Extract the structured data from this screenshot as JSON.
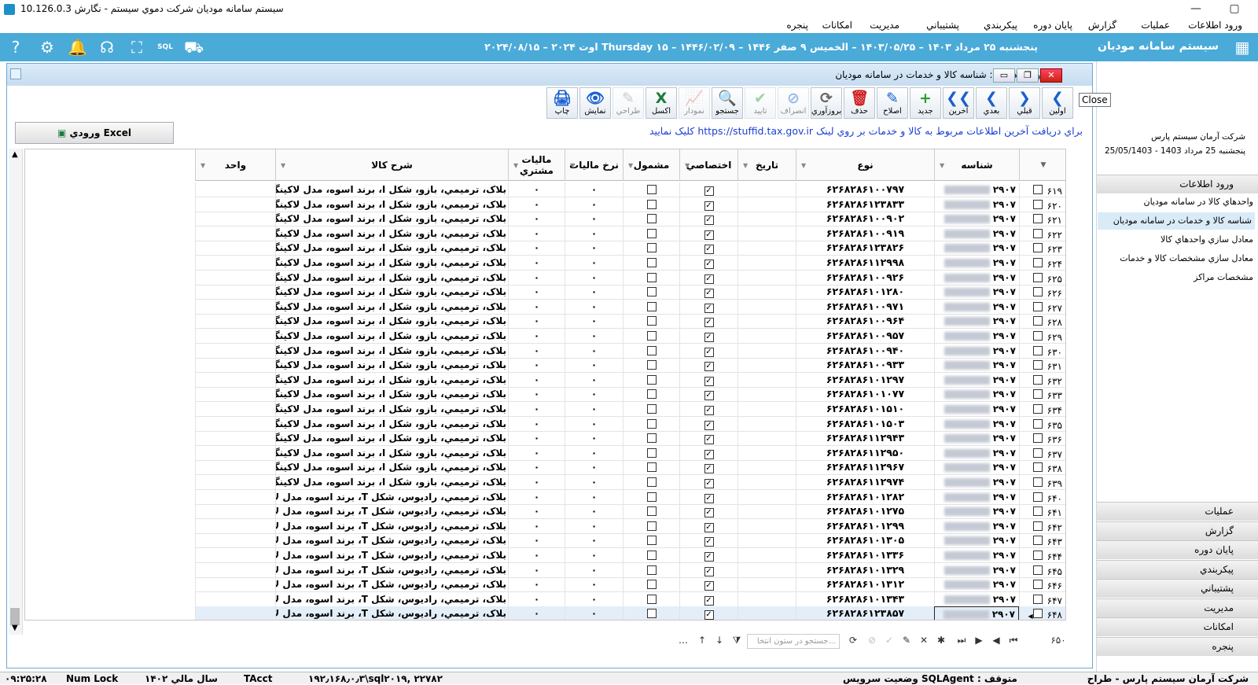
{
  "window": {
    "title": "سيستم سامانه موديان شرکت دموي سيستم - نگارش 10.126.0.3"
  },
  "menu": [
    "ورود اطلاعات",
    "عمليات",
    "گزارش",
    "پايان دوره",
    "پيکربندي",
    "پشتيباني",
    "مديريت",
    "امکانات",
    "پنجره"
  ],
  "header": {
    "app_name": "سيستم سامانه موديان",
    "date_line": "پنجشنبه ۲۵ مرداد ۱۴۰۳ – ۱۴۰۳/۰۵/۲۵ – الخميس ۹ صفر ۱۴۴۶ – ۱۴۴۶/۰۲/۰۹ – Thursday ۱۵ اوت ۲۰۲۴ – ۲۰۲۴/۰۸/۱۵",
    "icons": [
      "help-icon",
      "settings-icon",
      "bell-icon",
      "support-icon",
      "gift-icon",
      "sql-icon",
      "truck-icon"
    ]
  },
  "right_panel": {
    "company": "شرکت آرمان سيستم پارس",
    "date": "پنجشنبه 25 مرداد 1403 - 25/05/1403",
    "sections": [
      {
        "label": "ورود اطلاعات",
        "items": [
          "واحدهاي کالا در سامانه موديان",
          "شناسه کالا و خدمات در سامانه موديان",
          "معادل سازي واحدهاي کالا",
          "معادل سازي  مشخصات کالا و خدمات",
          "مشخصات مراکز"
        ],
        "selected": 1
      }
    ],
    "collapsed": [
      "عمليات",
      "گزارش",
      "پايان دوره",
      "پيکربندي",
      "پشتيباني",
      "مديريت",
      "امکانات",
      "پنجره"
    ]
  },
  "child_window": {
    "title": "ورود اطلاعات : شناسه کالا و خدمات در سامانه موديان",
    "tooltip": "Close"
  },
  "toolbar": [
    {
      "id": "first",
      "label": "اولين",
      "glyph": "❮",
      "color": "#1a5fd0",
      "disabled": false
    },
    {
      "id": "prev",
      "label": "قبلي",
      "glyph": "❯",
      "color": "#1a5fd0",
      "disabled": false
    },
    {
      "id": "next",
      "label": "بعدي",
      "glyph": "❮",
      "color": "#1a5fd0",
      "disabled": false
    },
    {
      "id": "last",
      "label": "آخرين",
      "glyph": "❮❮",
      "color": "#1a5fd0",
      "disabled": false
    },
    {
      "id": "new",
      "label": "جديد",
      "glyph": "+",
      "color": "#2e9d2e",
      "disabled": false
    },
    {
      "id": "edit",
      "label": "اصلاح",
      "glyph": "✎",
      "color": "#1a5fd0",
      "disabled": false
    },
    {
      "id": "delete",
      "label": "حذف",
      "glyph": "🗑",
      "color": "#d02020",
      "disabled": false
    },
    {
      "id": "refresh",
      "label": "بروزآوري",
      "glyph": "⟳",
      "color": "#666",
      "disabled": false
    },
    {
      "id": "cancel",
      "label": "انصراف",
      "glyph": "⊘",
      "color": "#1a5fd0",
      "disabled": true
    },
    {
      "id": "confirm",
      "label": "تاييد",
      "glyph": "✔",
      "color": "#2e9d2e",
      "disabled": true
    },
    {
      "id": "search",
      "label": "جستجو",
      "glyph": "🔍",
      "color": "#1a5fd0",
      "disabled": false
    },
    {
      "id": "chart",
      "label": "نمودار",
      "glyph": "📈",
      "color": "#1a5fd0",
      "disabled": true
    },
    {
      "id": "excel",
      "label": "اکسل",
      "glyph": "X",
      "color": "#1e7a3c",
      "disabled": false
    },
    {
      "id": "design",
      "label": "طراحي",
      "glyph": "✎",
      "color": "#888",
      "disabled": true
    },
    {
      "id": "view",
      "label": "نمايش",
      "glyph": "👁",
      "color": "#1a5fd0",
      "disabled": false
    },
    {
      "id": "print",
      "label": "چاپ",
      "glyph": "🖨",
      "color": "#1a5fd0",
      "disabled": false
    }
  ],
  "excel_button": "ورودي Excel",
  "link_message": "براي دريافت آخرين اطلاعات مربوط به کالا و خدمات بر روي لينک https://stuffid.tax.gov.ir کليک نماييد",
  "columns": {
    "id": "شناسه",
    "type": "نوع",
    "date": "تاريخ",
    "special": "اختصاصي",
    "included": "مشمول",
    "tax_rate": "نرخ ماليات",
    "buyer_tax": "ماليات مشتري",
    "desc": "شرح کالا",
    "unit": "واحد"
  },
  "rows": [
    {
      "n": "۶۱۹",
      "id": "۲۹۰۷",
      "type": "۶۲۶۸۲۸۶۱۰۰۷۹۷",
      "desc": "بلاک، ترميمي، بازو، شکل I، برند اسوه، مدل لاکينگ"
    },
    {
      "n": "۶۲۰",
      "id": "۲۹۰۷",
      "type": "۶۲۶۸۲۸۶۱۲۳۸۳۳",
      "desc": "بلاک، ترميمي، بازو، شکل I، برند اسوه، مدل لاکينگ"
    },
    {
      "n": "۶۲۱",
      "id": "۲۹۰۷",
      "type": "۶۲۶۸۲۸۶۱۰۰۹۰۲",
      "desc": "بلاک، ترميمي، بازو، شکل I، برند اسوه، مدل لاکينگ"
    },
    {
      "n": "۶۲۲",
      "id": "۲۹۰۷",
      "type": "۶۲۶۸۲۸۶۱۰۰۹۱۹",
      "desc": "بلاک، ترميمي، بازو، شکل I، برند اسوه، مدل لاکينگ"
    },
    {
      "n": "۶۲۳",
      "id": "۲۹۰۷",
      "type": "۶۲۶۸۲۸۶۱۲۳۸۲۶",
      "desc": "بلاک، ترميمي، بازو، شکل I، برند اسوه، مدل لاکينگ"
    },
    {
      "n": "۶۲۴",
      "id": "۲۹۰۷",
      "type": "۶۲۶۸۲۸۶۱۱۲۹۹۸",
      "desc": "بلاک، ترميمي، بازو، شکل I، برند اسوه، مدل لاکينگ"
    },
    {
      "n": "۶۲۵",
      "id": "۲۹۰۷",
      "type": "۶۲۶۸۲۸۶۱۰۰۹۲۶",
      "desc": "بلاک، ترميمي، بازو، شکل I، برند اسوه، مدل لاکينگ"
    },
    {
      "n": "۶۲۶",
      "id": "۲۹۰۷",
      "type": "۶۲۶۸۲۸۶۱۰۱۲۸۰",
      "desc": "بلاک، ترميمي، بازو، شکل I، برند اسوه، مدل لاکينگ"
    },
    {
      "n": "۶۲۷",
      "id": "۲۹۰۷",
      "type": "۶۲۶۸۲۸۶۱۰۰۹۷۱",
      "desc": "بلاک، ترميمي، بازو، شکل I، برند اسوه، مدل لاکينگ"
    },
    {
      "n": "۶۲۸",
      "id": "۲۹۰۷",
      "type": "۶۲۶۸۲۸۶۱۰۰۹۶۴",
      "desc": "بلاک، ترميمي، بازو، شکل I، برند اسوه، مدل لاکينگ"
    },
    {
      "n": "۶۲۹",
      "id": "۲۹۰۷",
      "type": "۶۲۶۸۲۸۶۱۰۰۹۵۷",
      "desc": "بلاک، ترميمي، بازو، شکل I، برند اسوه، مدل لاکينگ"
    },
    {
      "n": "۶۳۰",
      "id": "۲۹۰۷",
      "type": "۶۲۶۸۲۸۶۱۰۰۹۴۰",
      "desc": "بلاک، ترميمي، بازو، شکل I، برند اسوه، مدل لاکينگ"
    },
    {
      "n": "۶۳۱",
      "id": "۲۹۰۷",
      "type": "۶۲۶۸۲۸۶۱۰۰۹۳۳",
      "desc": "بلاک، ترميمي، بازو، شکل I، برند اسوه، مدل لاکينگ"
    },
    {
      "n": "۶۳۲",
      "id": "۲۹۰۷",
      "type": "۶۲۶۸۲۸۶۱۰۱۲۹۷",
      "desc": "بلاک، ترميمي، بازو، شکل I، برند اسوه، مدل لاکينگ"
    },
    {
      "n": "۶۳۳",
      "id": "۲۹۰۷",
      "type": "۶۲۶۸۲۸۶۱۰۱۰۷۷",
      "desc": "بلاک، ترميمي، بازو، شکل I، برند اسوه، مدل لاکينگ"
    },
    {
      "n": "۶۳۴",
      "id": "۲۹۰۷",
      "type": "۶۲۶۸۲۸۶۱۰۱۵۱۰",
      "desc": "بلاک، ترميمي، بازو، شکل I، برند اسوه، مدل لاکينگ"
    },
    {
      "n": "۶۳۵",
      "id": "۲۹۰۷",
      "type": "۶۲۶۸۲۸۶۱۰۱۵۰۳",
      "desc": "بلاک، ترميمي، بازو، شکل I، برند اسوه، مدل لاکينگ"
    },
    {
      "n": "۶۳۶",
      "id": "۲۹۰۷",
      "type": "۶۲۶۸۲۸۶۱۱۲۹۴۳",
      "desc": "بلاک، ترميمي، بازو، شکل I، برند اسوه، مدل لاکينگ"
    },
    {
      "n": "۶۳۷",
      "id": "۲۹۰۷",
      "type": "۶۲۶۸۲۸۶۱۱۲۹۵۰",
      "desc": "بلاک، ترميمي، بازو، شکل I، برند اسوه، مدل لاکينگ"
    },
    {
      "n": "۶۳۸",
      "id": "۲۹۰۷",
      "type": "۶۲۶۸۲۸۶۱۱۲۹۶۷",
      "desc": "بلاک، ترميمي، بازو، شکل I، برند اسوه، مدل لاکينگ"
    },
    {
      "n": "۶۳۹",
      "id": "۲۹۰۷",
      "type": "۶۲۶۸۲۸۶۱۱۲۹۷۴",
      "desc": "بلاک، ترميمي، بازو، شکل I، برند اسوه، مدل لاکينگ"
    },
    {
      "n": "۶۴۰",
      "id": "۲۹۰۷",
      "type": "۶۲۶۸۲۸۶۱۰۱۲۸۲",
      "desc": "بلاک، ترميمي، راديوس، شکل T، برند اسوه، مدل لاک"
    },
    {
      "n": "۶۴۱",
      "id": "۲۹۰۷",
      "type": "۶۲۶۸۲۸۶۱۰۱۲۷۵",
      "desc": "بلاک، ترميمي، راديوس، شکل T، برند اسوه، مدل لاک"
    },
    {
      "n": "۶۴۲",
      "id": "۲۹۰۷",
      "type": "۶۲۶۸۲۸۶۱۰۱۲۹۹",
      "desc": "بلاک، ترميمي، راديوس، شکل T، برند اسوه، مدل لاک"
    },
    {
      "n": "۶۴۳",
      "id": "۲۹۰۷",
      "type": "۶۲۶۸۲۸۶۱۰۱۳۰۵",
      "desc": "بلاک، ترميمي، راديوس، شکل T، برند اسوه، مدل لاک"
    },
    {
      "n": "۶۴۴",
      "id": "۲۹۰۷",
      "type": "۶۲۶۸۲۸۶۱۰۱۳۳۶",
      "desc": "بلاک، ترميمي، راديوس، شکل T، برند اسوه، مدل لاک"
    },
    {
      "n": "۶۴۵",
      "id": "۲۹۰۷",
      "type": "۶۲۶۸۲۸۶۱۰۱۳۲۹",
      "desc": "بلاک، ترميمي، راديوس، شکل T، برند اسوه، مدل لاک"
    },
    {
      "n": "۶۴۶",
      "id": "۲۹۰۷",
      "type": "۶۲۶۸۲۸۶۱۰۱۳۱۲",
      "desc": "بلاک، ترميمي، راديوس، شکل T، برند اسوه، مدل لاک"
    },
    {
      "n": "۶۴۷",
      "id": "۲۹۰۷",
      "type": "۶۲۶۸۲۸۶۱۰۱۳۴۳",
      "desc": "بلاک، ترميمي، راديوس، شکل T، برند اسوه، مدل لاک"
    },
    {
      "n": "۶۴۸",
      "id": "۲۹۰۷",
      "type": "۶۲۶۸۲۸۶۱۲۳۸۵۷",
      "desc": "بلاک، ترميمي، راديوس، شکل T، برند اسوه، مدل لاک"
    }
  ],
  "row_defaults": {
    "tax_rate": "۰",
    "buyer_tax": "۰",
    "special_checked": true,
    "included_checked": false
  },
  "selected_row": 29,
  "navigator": {
    "count": "۶۵۰",
    "search_placeholder": "جستجو در ستون انتخا..."
  },
  "status": {
    "time": "۰۹:۲۵:۲۸",
    "numlock": "Num Lock",
    "fiscal": "سال مالي ۱۴۰۲",
    "module": "TAcct",
    "server": "۱۹۲٫۱۶۸٫۰٫۳\\sql۲۰۱۹, ۲۲۷۸۲",
    "service": "متوقف : SQLAgent وضعيت سرويس",
    "company": "شرکت آرمان سيستم پارس - طراح"
  }
}
